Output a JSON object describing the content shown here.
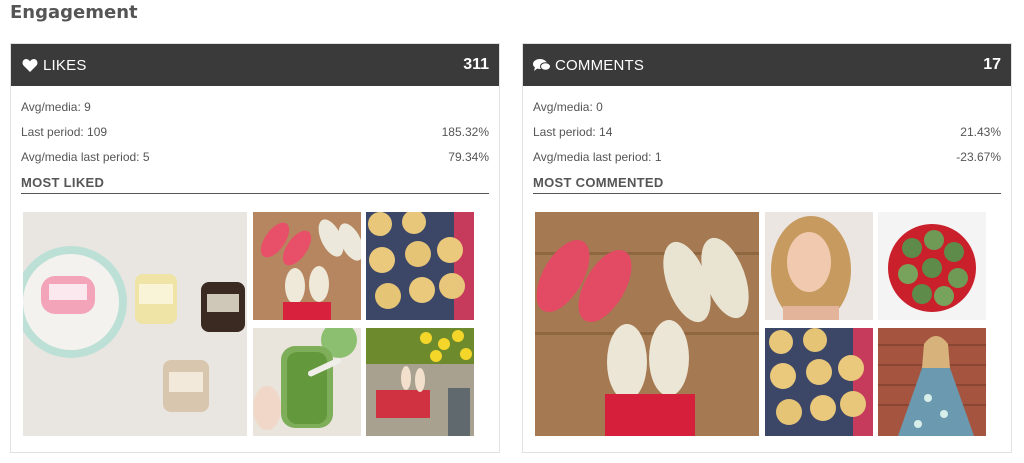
{
  "section_title": "Engagement",
  "likes": {
    "title": "LIKES",
    "icon": "heart-icon",
    "count": "311",
    "avg_media": "Avg/media: 9",
    "last_period": "Last period: 109",
    "last_period_change": "185.32%",
    "avg_media_last_period": "Avg/media last period: 5",
    "avg_media_last_period_change": "79.34%",
    "subtitle": "MOST LIKED"
  },
  "comments": {
    "title": "COMMENTS",
    "icon": "speech-bubbles-icon",
    "count": "17",
    "avg_media": "Avg/media: 0",
    "last_period": "Last period: 14",
    "last_period_change": "21.43%",
    "avg_media_last_period": "Avg/media last period: 1",
    "avg_media_last_period_change": "-23.67%",
    "subtitle": "MOST COMMENTED"
  },
  "colors": {
    "header_bg": "#3a3a3a",
    "header_text": "#ffffff",
    "body_text": "#555555"
  }
}
